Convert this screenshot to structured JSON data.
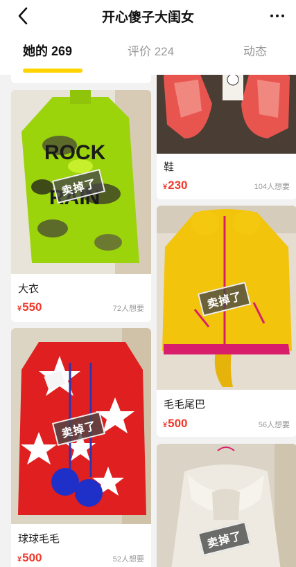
{
  "header": {
    "title": "开心傻子大闺女",
    "back_icon": "chevron-left-icon",
    "more_icon": "more-dots-icon"
  },
  "tabs": [
    {
      "label": "她的 269",
      "active": true
    },
    {
      "label": "评价 224",
      "active": false
    },
    {
      "label": "动态",
      "active": false
    }
  ],
  "accent_color": "#ffd400",
  "price_color": "#f0392b",
  "currency_symbol": "¥",
  "sold_label": "卖掉了",
  "items": [
    {
      "name": "大衣",
      "price": "550",
      "wants": "72人想要",
      "sold": true,
      "photo": "green camo coat"
    },
    {
      "name": "球球毛毛",
      "price": "500",
      "wants": "52人想要",
      "sold": true,
      "photo": "red star fluffy jacket"
    },
    {
      "name": "鞋",
      "price": "230",
      "wants": "104人想要",
      "sold": false,
      "photo": "pink shoes"
    },
    {
      "name": "毛毛尾巴",
      "price": "500",
      "wants": "56人想要",
      "sold": true,
      "photo": "yellow fluffy jacket"
    },
    {
      "name": "",
      "price": "",
      "wants": "",
      "sold": true,
      "photo": "white knit coat"
    }
  ]
}
